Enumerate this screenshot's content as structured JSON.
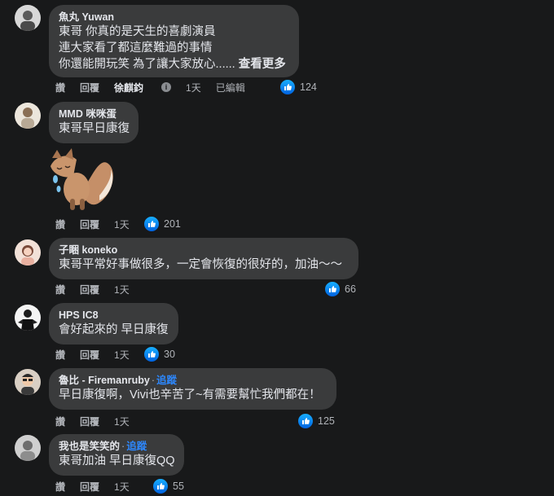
{
  "labels": {
    "like": "讚",
    "reply": "回覆"
  },
  "colors": {
    "background": "#18191a",
    "bubble": "#3a3b3c",
    "link": "#2d88ff",
    "like_blue": "#1877f2"
  },
  "comments": [
    {
      "author": "魚丸 Yuwan",
      "lines": [
        "東哥 你真的是天生的喜劇演員",
        "連大家看了都這麼難過的事情",
        "你還能開玩笑 為了讓大家放心......"
      ],
      "see_more": "查看更多",
      "editor_name": "徐麒鈞",
      "time": "1天",
      "edited": "已編輯",
      "reactions": "124"
    },
    {
      "author": "MMD 咪咪蛋",
      "lines": [
        "東哥早日康復"
      ],
      "time": "1天",
      "reactions": "201"
    },
    {
      "author": "子睏 koneko",
      "lines": [
        "東哥平常好事做很多，一定會恢復的很好的，加油～～"
      ],
      "time": "1天",
      "reactions": "66"
    },
    {
      "author": "HPS IC8",
      "lines": [
        "會好起來的 早日康復"
      ],
      "time": "1天",
      "reactions": "30"
    },
    {
      "author": "魯比 - Firemanruby",
      "follow": "追蹤",
      "lines": [
        "早日康復啊，Vivi也辛苦了~有需要幫忙我們都在！"
      ],
      "time": "1天",
      "reactions": "125"
    },
    {
      "author": "我也是笑笑的",
      "follow": "追蹤",
      "lines": [
        "東哥加油 早日康復QQ"
      ],
      "time": "1天",
      "reactions": "55"
    }
  ]
}
